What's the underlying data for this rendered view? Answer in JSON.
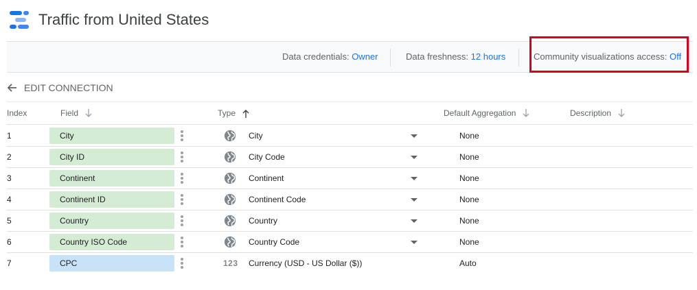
{
  "header": {
    "title": "Traffic from United States",
    "logo": "data-studio-logo-icon"
  },
  "toolbar": {
    "credentials_label": "Data credentials:",
    "credentials_value": "Owner",
    "freshness_label": "Data freshness:",
    "freshness_value": "12 hours",
    "community_label": "Community visualizations access:",
    "community_value": "Off"
  },
  "edit_connection": {
    "label": "EDIT CONNECTION",
    "icon": "arrow-back-icon"
  },
  "table": {
    "headers": {
      "index": "Index",
      "field": "Field",
      "type": "Type",
      "aggregation": "Default Aggregation",
      "description": "Description"
    },
    "rows": [
      {
        "index": "1",
        "field": "City",
        "kind": "dimension",
        "type_icon": "globe-icon",
        "type": "City",
        "aggregation": "None"
      },
      {
        "index": "2",
        "field": "City ID",
        "kind": "dimension",
        "type_icon": "globe-icon",
        "type": "City Code",
        "aggregation": "None"
      },
      {
        "index": "3",
        "field": "Continent",
        "kind": "dimension",
        "type_icon": "globe-icon",
        "type": "Continent",
        "aggregation": "None"
      },
      {
        "index": "4",
        "field": "Continent ID",
        "kind": "dimension",
        "type_icon": "globe-icon",
        "type": "Continent Code",
        "aggregation": "None"
      },
      {
        "index": "5",
        "field": "Country",
        "kind": "dimension",
        "type_icon": "globe-icon",
        "type": "Country",
        "aggregation": "None"
      },
      {
        "index": "6",
        "field": "Country ISO Code",
        "kind": "dimension",
        "type_icon": "globe-icon",
        "type": "Country Code",
        "aggregation": "None"
      },
      {
        "index": "7",
        "field": "CPC",
        "kind": "metric",
        "type_icon_text": "123",
        "type": "Currency (USD - US Dollar ($))",
        "aggregation": "Auto"
      }
    ]
  },
  "colors": {
    "link": "#1a73e8",
    "dimension_chip": "#d4ebd4",
    "metric_chip": "#c8e2f8",
    "highlight_box": "#d9001b"
  }
}
